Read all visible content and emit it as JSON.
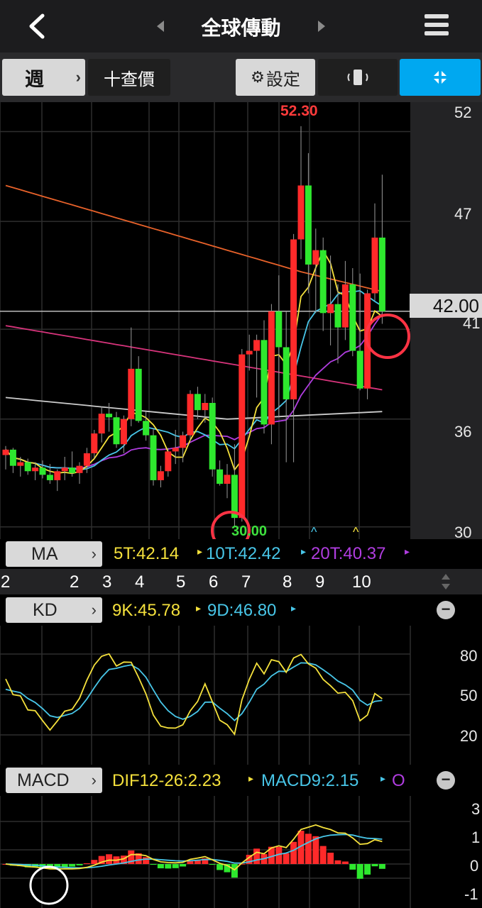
{
  "header": {
    "title": "全球傳動",
    "back_icon": "chevron-left-icon",
    "menu_icon": "hamburger-menu-icon"
  },
  "toolbar": {
    "period": "週",
    "add_quote": "十查價",
    "settings": "設定",
    "colors": {
      "active": "#00a8f0",
      "button": "#1f1f1f",
      "light_button": "#d8d8d8"
    }
  },
  "price_chart": {
    "high_label": "52.30",
    "low_label": "30.00",
    "current_price": "42.00",
    "y_axis_labels": [
      "52",
      "47",
      "41",
      "36",
      "30"
    ],
    "marker_glyph": "^"
  },
  "ma_bar": {
    "label": "MA",
    "ma5": "5T:42.14",
    "ma10": "10T:42.42",
    "ma20": "20T:40.37"
  },
  "date_axis": {
    "labels": [
      "2",
      "2",
      "3",
      "4",
      "5",
      "6",
      "7",
      "8",
      "9",
      "10"
    ]
  },
  "kd_bar": {
    "label": "KD",
    "k": "9K:45.78",
    "d": "9D:46.80"
  },
  "kd_chart": {
    "y_axis_labels": [
      "80",
      "50",
      "20"
    ]
  },
  "macd_bar": {
    "label": "MACD",
    "dif": "DIF12-26:2.23",
    "macd": "MACD9:2.15",
    "osc": "O"
  },
  "macd_chart": {
    "y_axis_labels": [
      "3",
      "1",
      "0",
      "-1"
    ]
  },
  "chart_data": {
    "type": "candlestick",
    "series": [
      {
        "name": "5T",
        "color": "#f5e13c"
      },
      {
        "name": "10T",
        "color": "#48c6e8"
      },
      {
        "name": "20T",
        "color": "#b03de0"
      },
      {
        "name": "9K",
        "color": "#f5e13c"
      },
      {
        "name": "9D",
        "color": "#48c6e8"
      },
      {
        "name": "DIF12-26",
        "color": "#f5e13c"
      },
      {
        "name": "MACD9",
        "color": "#48c6e8"
      }
    ],
    "price_range": [
      30,
      52.3
    ],
    "candles": [
      [
        34.0,
        34.5,
        33.2,
        34.3
      ],
      [
        34.3,
        34.4,
        33.0,
        33.4
      ],
      [
        33.4,
        33.9,
        32.8,
        33.6
      ],
      [
        33.6,
        33.8,
        32.9,
        33.1
      ],
      [
        33.1,
        33.6,
        32.6,
        33.3
      ],
      [
        33.3,
        33.7,
        32.7,
        32.9
      ],
      [
        32.9,
        33.5,
        32.4,
        32.6
      ],
      [
        32.6,
        33.2,
        32.0,
        33.1
      ],
      [
        33.1,
        33.9,
        32.6,
        33.3
      ],
      [
        33.3,
        34.2,
        32.8,
        33.0
      ],
      [
        33.0,
        33.6,
        32.4,
        33.4
      ],
      [
        33.4,
        34.4,
        33.0,
        34.1
      ],
      [
        34.1,
        35.4,
        33.8,
        35.2
      ],
      [
        35.2,
        36.7,
        34.7,
        36.3
      ],
      [
        36.3,
        36.9,
        35.3,
        36.1
      ],
      [
        36.1,
        36.4,
        34.4,
        34.6
      ],
      [
        34.6,
        36.2,
        34.1,
        36.0
      ],
      [
        36.0,
        41.1,
        35.6,
        38.8
      ],
      [
        38.8,
        39.5,
        35.8,
        35.9
      ],
      [
        35.9,
        36.4,
        34.8,
        35.1
      ],
      [
        35.1,
        35.5,
        32.3,
        32.6
      ],
      [
        32.6,
        33.4,
        32.2,
        33.1
      ],
      [
        33.1,
        34.4,
        32.8,
        34.2
      ],
      [
        34.2,
        35.4,
        33.5,
        34.4
      ],
      [
        34.4,
        35.3,
        33.6,
        35.1
      ],
      [
        35.1,
        37.6,
        34.8,
        37.4
      ],
      [
        37.4,
        37.8,
        36.0,
        36.5
      ],
      [
        36.5,
        37.4,
        35.8,
        36.9
      ],
      [
        36.9,
        37.2,
        32.8,
        33.2
      ],
      [
        33.2,
        33.7,
        32.3,
        32.4
      ],
      [
        32.4,
        33.5,
        31.6,
        32.9
      ],
      [
        32.9,
        34.6,
        30.0,
        30.5
      ],
      [
        30.5,
        39.9,
        30.3,
        39.6
      ],
      [
        39.6,
        40.7,
        38.7,
        39.8
      ],
      [
        39.8,
        40.7,
        37.2,
        40.4
      ],
      [
        40.4,
        41.5,
        35.2,
        35.7
      ],
      [
        35.7,
        42.4,
        34.6,
        42.0
      ],
      [
        42.0,
        44.0,
        36.1,
        40.0
      ],
      [
        40.0,
        42.0,
        33.6,
        37.1
      ],
      [
        37.1,
        46.3,
        33.6,
        46.0
      ],
      [
        46.0,
        52.3,
        44.9,
        49.0
      ],
      [
        49.0,
        50.8,
        43.0,
        44.6
      ],
      [
        44.6,
        46.6,
        41.9,
        45.4
      ],
      [
        45.4,
        46.1,
        40.9,
        41.9
      ],
      [
        41.9,
        45.1,
        40.1,
        42.4
      ],
      [
        42.4,
        43.5,
        39.1,
        41.1
      ],
      [
        41.1,
        44.8,
        40.4,
        43.5
      ],
      [
        43.5,
        44.4,
        39.5,
        39.8
      ],
      [
        39.8,
        44.1,
        37.6,
        37.7
      ],
      [
        37.7,
        43.2,
        37.1,
        43.0
      ],
      [
        43.0,
        48.0,
        42.6,
        46.1
      ],
      [
        46.1,
        49.6,
        41.3,
        42.0
      ]
    ]
  }
}
